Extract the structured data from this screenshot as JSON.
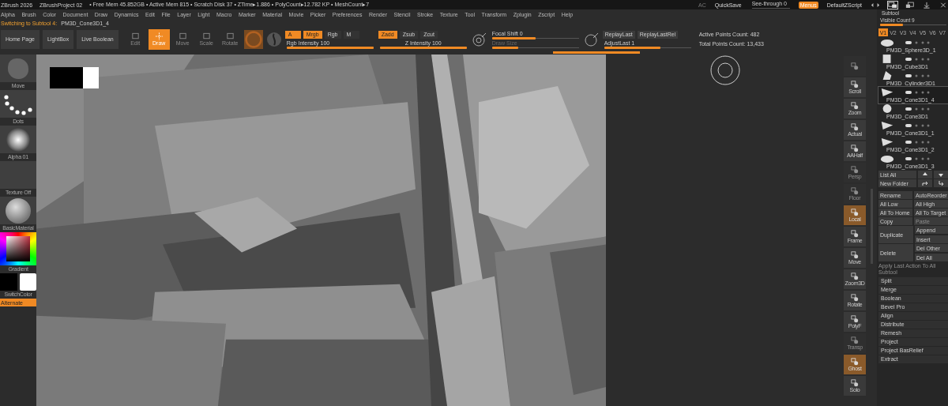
{
  "app_bar": {
    "app": "ZBrush 2026",
    "project": "ZBrushProject 02",
    "stats": "• Free Mem 45.852GB • Active Mem 815 • Scratch Disk 37 • ZTime▸1.886 • PolyCount▸12.782 KP • MeshCount▸7",
    "ac": "AC",
    "quicksave": "QuickSave",
    "see_through": {
      "label": "See-through",
      "value": "0",
      "level": 0
    },
    "menus": {
      "label": "Menus",
      "on": true
    },
    "script": "DefaultZScript"
  },
  "menu": [
    "Alpha",
    "Brush",
    "Color",
    "Document",
    "Draw",
    "Dynamics",
    "Edit",
    "File",
    "Layer",
    "Light",
    "Macro",
    "Marker",
    "Material",
    "Movie",
    "Picker",
    "Preferences",
    "Render",
    "Stencil",
    "Stroke",
    "Texture",
    "Tool",
    "Transform",
    "Zplugin",
    "Zscript",
    "Help"
  ],
  "notice": {
    "label": "Switching to Subtool 4:",
    "value": "PM3D_Cone3D1_4"
  },
  "toolbar": {
    "buttons": [
      "Home Page",
      "LightBox",
      "Live Boolean"
    ],
    "modes": [
      {
        "label": "Edit",
        "selected": false,
        "disabled": true
      },
      {
        "label": "Draw",
        "selected": true,
        "disabled": false
      },
      {
        "label": "Move",
        "selected": false,
        "disabled": true
      },
      {
        "label": "Scale",
        "selected": false,
        "disabled": true
      },
      {
        "label": "Rotate",
        "selected": false,
        "disabled": true
      }
    ],
    "rgb_channels": [
      {
        "label": "A",
        "on": true
      },
      {
        "label": "Mrgb",
        "on": true
      },
      {
        "label": "Rgb",
        "on": false
      },
      {
        "label": "M",
        "on": false
      }
    ],
    "z_channels": [
      {
        "label": "Zadd",
        "on": true
      },
      {
        "label": "Zsub",
        "on": false
      },
      {
        "label": "Zcut",
        "on": false
      }
    ],
    "rgb_intensity": {
      "label": "Rgb Intensity",
      "value": "100",
      "level": 1
    },
    "z_intensity": {
      "label": "Z Intensity",
      "value": "100",
      "level": 1
    },
    "focal_shift": {
      "label": "Focal Shift",
      "value": "0",
      "level": 0.5
    },
    "draw_size": {
      "label": "Draw Size",
      "level": 0.3,
      "disabled": true
    },
    "replay": [
      "ReplayLast",
      "ReplayLastRel"
    ],
    "adjust_last": {
      "label": "AdjustLast",
      "value": "1",
      "level": 0.65
    },
    "active_points": "Active Points Count: 482",
    "total_points": "Total Points Count: 13,433",
    "progress": {
      "level": 1
    }
  },
  "shelf": [
    {
      "kind": "brush",
      "label": "Move"
    },
    {
      "kind": "stroke",
      "label": "Dots"
    },
    {
      "kind": "alpha",
      "label": "Alpha 01"
    },
    {
      "kind": "texture",
      "label": "Texture Off"
    },
    {
      "kind": "material",
      "label": "BasicMaterial"
    },
    {
      "kind": "gradient",
      "label": "Gradient"
    },
    {
      "kind": "swatches",
      "label": "SwitchColor"
    },
    {
      "kind": "toggle",
      "label": "Alternate",
      "on": true
    }
  ],
  "view_tools": [
    {
      "on": false,
      "disabled": true
    },
    {
      "label": "Scroll",
      "on": false,
      "disabled": false
    },
    {
      "label": "Zoom",
      "on": false,
      "disabled": false
    },
    {
      "label": "Actual",
      "on": false,
      "disabled": false
    },
    {
      "label": "AAHalf",
      "on": false,
      "disabled": false
    },
    {
      "label": "Persp",
      "on": false,
      "disabled": true
    },
    {
      "label": "Floor",
      "on": false,
      "disabled": true
    },
    {
      "label": "Local",
      "on": true,
      "disabled": false
    },
    {
      "label": "Frame",
      "on": false,
      "disabled": false
    },
    {
      "label": "Move",
      "on": false,
      "disabled": false
    },
    {
      "label": "Zoom3D",
      "on": false,
      "disabled": false
    },
    {
      "label": "Rotate",
      "on": false,
      "disabled": false
    },
    {
      "label": "PolyF",
      "on": false,
      "disabled": false
    },
    {
      "label": "Transp",
      "on": false,
      "disabled": true
    },
    {
      "label": "Ghost",
      "on": true,
      "disabled": false
    },
    {
      "label": "Solo",
      "on": false,
      "disabled": false
    }
  ],
  "subtool": {
    "title": "Subtool",
    "visible_count": {
      "label": "Visible Count",
      "value": "9",
      "level": 0.35
    },
    "versions": [
      {
        "label": "V1",
        "selected": true
      },
      {
        "label": "V2",
        "selected": false
      },
      {
        "label": "V3",
        "selected": false
      },
      {
        "label": "V4",
        "selected": false
      },
      {
        "label": "V5",
        "selected": false
      },
      {
        "label": "V6",
        "selected": false
      },
      {
        "label": "V7",
        "selected": false
      }
    ],
    "items": [
      {
        "name": "PM3D_Sphere3D_1",
        "kind": "ellipsoid",
        "selected": false
      },
      {
        "name": "PM3D_Cube3D1",
        "kind": "cube",
        "selected": false
      },
      {
        "name": "PM3D_Cylinder3D1",
        "kind": "cylinder",
        "selected": false
      },
      {
        "name": "PM3D_Cone3D1_4",
        "kind": "cone",
        "selected": true
      },
      {
        "name": "PM3D_Cone3D1",
        "kind": "sphere",
        "selected": false
      },
      {
        "name": "PM3D_Cone3D1_1",
        "kind": "cone",
        "selected": false
      },
      {
        "name": "PM3D_Cone3D1_2",
        "kind": "cone",
        "selected": false
      },
      {
        "name": "PM3D_Cone3D1_3",
        "kind": "ellipsoid",
        "selected": false
      }
    ],
    "list_all": "List All",
    "new_folder": "New Folder",
    "pairs": [
      [
        {
          "label": "Rename",
          "disabled": false
        },
        {
          "label": "AutoReorder",
          "disabled": false
        }
      ],
      [
        {
          "label": "All Low",
          "disabled": false
        },
        {
          "label": "All High",
          "disabled": false
        }
      ],
      [
        {
          "label": "All To Home",
          "disabled": false
        },
        {
          "label": "All To Target",
          "disabled": false
        }
      ],
      [
        {
          "label": "Copy",
          "disabled": false
        },
        {
          "label": "Paste",
          "disabled": true
        }
      ]
    ],
    "groups": [
      {
        "label": "Duplicate",
        "options": [
          "Append",
          "Insert"
        ]
      },
      {
        "label": "Delete",
        "options": [
          "Del Other",
          "Del All"
        ]
      }
    ],
    "apply": {
      "label": "Apply Last Action To All Subtool",
      "disabled": true
    },
    "actions": [
      "Split",
      "Merge",
      "Boolean",
      "Bevel Pro",
      "Align",
      "Distribute",
      "Remesh",
      "Project",
      "Project BasRelief",
      "Extract"
    ]
  }
}
